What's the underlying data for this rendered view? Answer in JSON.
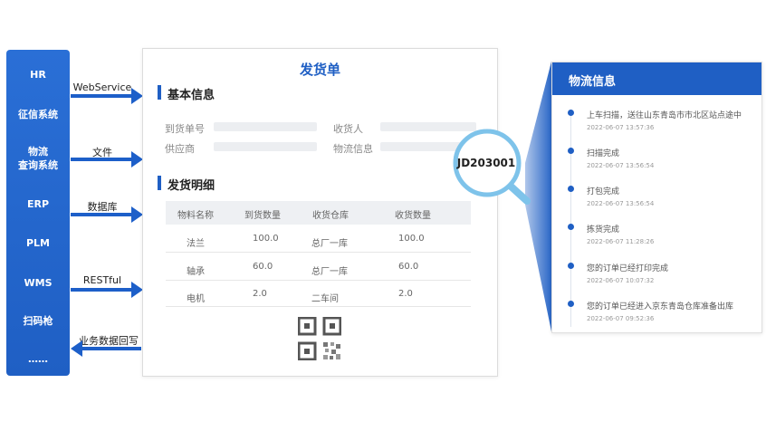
{
  "systems": [
    "HR",
    "征信系统",
    "物流\n查询系统",
    "ERP",
    "PLM",
    "WMS",
    "扫码枪",
    "……"
  ],
  "arrows": {
    "webservice": "WebService",
    "file": "文件",
    "database": "数据库",
    "restful": "RESTful",
    "writeback": "业务数据回写"
  },
  "doc": {
    "title": "发货单",
    "basic_info": "基本信息",
    "fields": {
      "arrival_no": "到货单号",
      "receiver": "收货人",
      "supplier": "供应商",
      "logistics_info": "物流信息"
    },
    "detail_title": "发货明细",
    "columns": [
      "物料名称",
      "到货数量",
      "收货仓库",
      "收货数量"
    ],
    "rows": [
      [
        "法兰",
        "100.0",
        "总厂一库",
        "100.0"
      ],
      [
        "轴承",
        "60.0",
        "总厂一库",
        "60.0"
      ],
      [
        "电机",
        "2.0",
        "二车间",
        "2.0"
      ]
    ]
  },
  "tracking_number": "JD203001",
  "logistics": {
    "title": "物流信息",
    "events": [
      {
        "text": "上车扫描，送往山东青岛市市北区站点途中",
        "time": "2022-06-07 13:57:36"
      },
      {
        "text": "扫描完成",
        "time": "2022-06-07 13:56:54"
      },
      {
        "text": "打包完成",
        "time": "2022-06-07 13:56:54"
      },
      {
        "text": "拣货完成",
        "time": "2022-06-07 11:28:26"
      },
      {
        "text": "您的订单已经打印完成",
        "time": "2022-06-07 10:07:32"
      },
      {
        "text": "您的订单已经进入京东青岛仓库准备出库",
        "time": "2022-06-07 09:52:36"
      }
    ]
  },
  "colors": {
    "brand_blue": "#1f5fc4",
    "panel_blue": "#2a6fd6",
    "arrow_blue": "#1d5fc9",
    "magnifier_ring": "#7ec3ea"
  }
}
